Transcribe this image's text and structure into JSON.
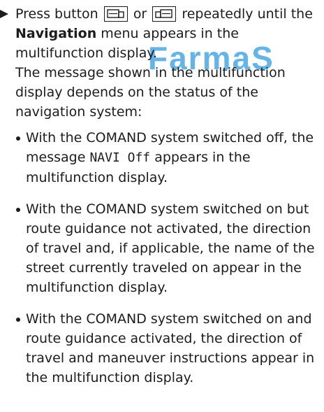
{
  "watermark": "FarmaS",
  "step": {
    "press": "Press button",
    "or": "or",
    "repeatedly": "repeatedly until the",
    "menu_name": "Navigation",
    "menu_suffix": "menu appears in the multifunction display.",
    "info": "The message shown in the multifunction display depends on the status of the navigation system:"
  },
  "icons": {
    "button_left": "display-page-left-icon",
    "button_right": "display-page-right-icon"
  },
  "bullets": {
    "item1_before": "With the COMAND system switched off, the message",
    "item1_code": "NAVI Off",
    "item1_after": "appears in the multifunction display.",
    "item2": "With the COMAND system switched on but route guidance not activated, the direction of travel and, if applicable, the name of the street currently traveled on appear in the multifunction display.",
    "item3": "With the COMAND system switched on and route guidance activated, the direction of travel and maneuver instructions appear in the multifunction display."
  },
  "colors": {
    "text": "#1c1c1c",
    "watermark": "#49a7e3"
  }
}
